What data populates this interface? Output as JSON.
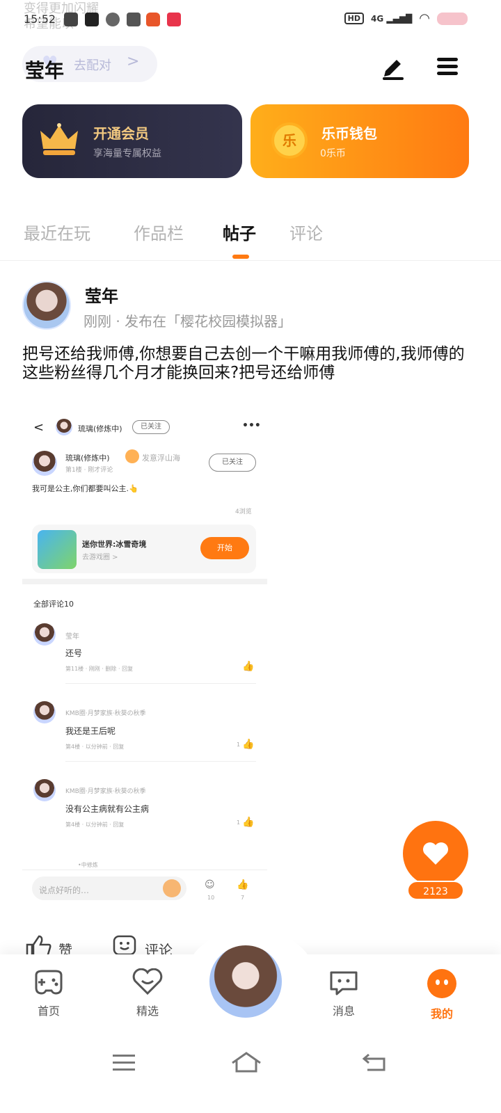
{
  "status_bar": {
    "time": "15:52",
    "overlay_text": [
      "变得更加闪耀",
      "希望能以"
    ],
    "network": "4G",
    "hd": "HD"
  },
  "header": {
    "username": "莹年",
    "pair_label": "去配对",
    "pair_chevron": ">"
  },
  "cards": {
    "vip": {
      "title": "开通会员",
      "subtitle": "享海量专属权益"
    },
    "wallet": {
      "title": "乐币钱包",
      "subtitle": "0乐币",
      "coin_glyph": "乐"
    }
  },
  "tabs": [
    {
      "label": "最近在玩"
    },
    {
      "label": "作品栏"
    },
    {
      "label": "帖子",
      "active": true
    },
    {
      "label": "评论"
    }
  ],
  "post": {
    "author": "莹年",
    "meta": "刚刚 · 发布在「樱花校园模拟器」",
    "text": "把号还给我师傅,你想要自己去创一个干嘛用我师傅的,我师傅的这些粉丝得几个月才能换回来?把号还给师傅"
  },
  "embedded": {
    "top_name": "琉璃(修炼中)",
    "top_follow": "已关注",
    "more": "•••",
    "back": "<",
    "user_name": "琉璃(修炼中)",
    "user_tag": "发意浮山海",
    "user_meta": "第1楼 · 刚才评论",
    "user_follow": "已关注",
    "content": "我可是公主,你们都要叫公主.👆",
    "views": "4浏览",
    "game_title": "迷你世界:冰雪奇境",
    "game_sub": "去游戏圈 >",
    "game_button": "开始",
    "comments_header": "全部评论10",
    "comments": [
      {
        "name": "莹年",
        "text": "还号",
        "meta": "第11楼 · 刚刚 · 删除 · 回复"
      },
      {
        "name": "KMB圈·月梦家族·秋葵の秋季",
        "text": "我还是王后呢",
        "meta": "第4楼 · 以分钟前 · 回复",
        "likes": "1"
      },
      {
        "name": "KMB圈·月梦家族·秋葵の秋季",
        "text": "没有公主病就有公主病",
        "meta": "第4楼 · 以分钟前 · 回复",
        "likes": "1"
      }
    ],
    "truncated_name": "•中修炼",
    "input_placeholder": "说点好听的…",
    "comment_count": "10",
    "like_count": "7"
  },
  "actions": {
    "like_label": "赞",
    "comment_label": "评论",
    "like_total": "2123"
  },
  "bottom_nav": [
    {
      "label": "首页",
      "icon": "gamepad-icon"
    },
    {
      "label": "精选",
      "icon": "heart-icon"
    },
    {
      "label": "消息",
      "icon": "message-icon"
    },
    {
      "label": "我的",
      "icon": "profile-icon",
      "active": true
    }
  ],
  "colors": {
    "accent": "#ff7a12",
    "vip_gold": "#f3c980",
    "dark_card": "#2a2a3e"
  }
}
